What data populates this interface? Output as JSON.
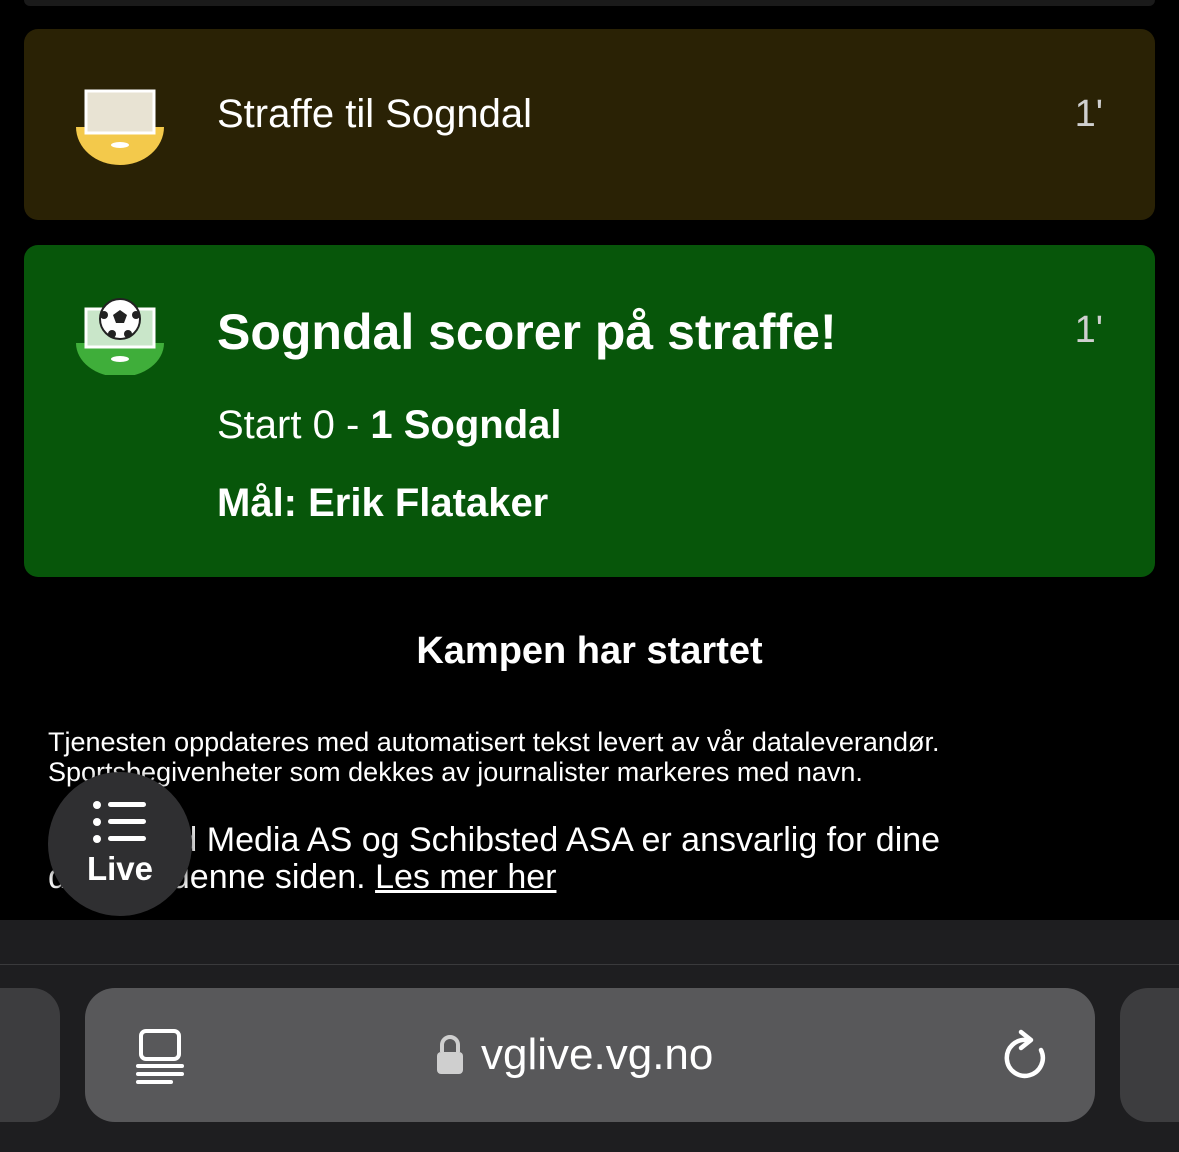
{
  "events": [
    {
      "type": "penalty",
      "icon": "penalty-icon",
      "text": "Straffe til Sogndal",
      "minute": "1'",
      "color": "#2a2205"
    },
    {
      "type": "goal",
      "icon": "goal-icon",
      "title": "Sogndal scorer på straffe!",
      "score_prefix": "Start 0 - ",
      "score_bold": "1 Sogndal",
      "scorer": "Mål: Erik Flataker",
      "minute": "1'",
      "color": "#07560a"
    }
  ],
  "section_title": "Kampen har startet",
  "info_text": "Tjenesten oppdateres med automatisert tekst levert av vår dataleverandør. Sportsbegivenheter som dekkes av journalister markeres med navn.",
  "privacy": {
    "text_line1": "Schibsted Media AS og Schibsted ASA er ansvarlig for dine",
    "text_line2_prefix": "data på denne siden. ",
    "link": "Les mer her"
  },
  "live_button": {
    "label": "Live",
    "icon": "list-icon"
  },
  "browser": {
    "url": "vglive.vg.no",
    "left_icon": "reader-icon",
    "lock_icon": "lock-icon",
    "right_icon": "reload-icon"
  }
}
